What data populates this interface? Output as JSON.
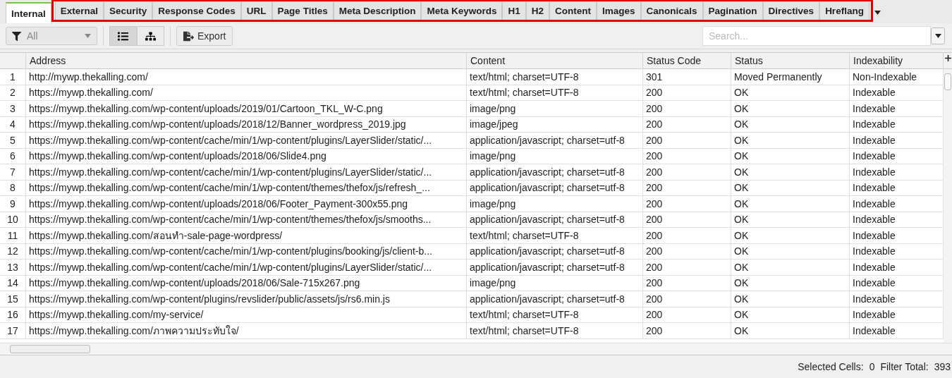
{
  "tabs": [
    {
      "label": "Internal",
      "selected": true,
      "highlighted": false
    },
    {
      "label": "External",
      "selected": false,
      "highlighted": true
    },
    {
      "label": "Security",
      "selected": false,
      "highlighted": true
    },
    {
      "label": "Response Codes",
      "selected": false,
      "highlighted": true
    },
    {
      "label": "URL",
      "selected": false,
      "highlighted": true
    },
    {
      "label": "Page Titles",
      "selected": false,
      "highlighted": true
    },
    {
      "label": "Meta Description",
      "selected": false,
      "highlighted": true
    },
    {
      "label": "Meta Keywords",
      "selected": false,
      "highlighted": true
    },
    {
      "label": "H1",
      "selected": false,
      "highlighted": true
    },
    {
      "label": "H2",
      "selected": false,
      "highlighted": true
    },
    {
      "label": "Content",
      "selected": false,
      "highlighted": true
    },
    {
      "label": "Images",
      "selected": false,
      "highlighted": true
    },
    {
      "label": "Canonicals",
      "selected": false,
      "highlighted": true
    },
    {
      "label": "Pagination",
      "selected": false,
      "highlighted": true
    },
    {
      "label": "Directives",
      "selected": false,
      "highlighted": true
    },
    {
      "label": "Hreflang",
      "selected": false,
      "highlighted": true
    }
  ],
  "toolbar": {
    "filter": "All",
    "view_modes": [
      {
        "kind": "list",
        "selected": true
      },
      {
        "kind": "tree",
        "selected": false
      }
    ],
    "export": "Export",
    "search_placeholder": "Search..."
  },
  "table": {
    "columns": [
      "",
      "Address",
      "Content",
      "Status Code",
      "Status",
      "Indexability"
    ],
    "rows": [
      [
        "1",
        "http://mywp.thekalling.com/",
        "text/html; charset=UTF-8",
        "301",
        "Moved Permanently",
        "Non-Indexable"
      ],
      [
        "2",
        "https://mywp.thekalling.com/",
        "text/html; charset=UTF-8",
        "200",
        "OK",
        "Indexable"
      ],
      [
        "3",
        "https://mywp.thekalling.com/wp-content/uploads/2019/01/Cartoon_TKL_W-C.png",
        "image/png",
        "200",
        "OK",
        "Indexable"
      ],
      [
        "4",
        "https://mywp.thekalling.com/wp-content/uploads/2018/12/Banner_wordpress_2019.jpg",
        "image/jpeg",
        "200",
        "OK",
        "Indexable"
      ],
      [
        "5",
        "https://mywp.thekalling.com/wp-content/cache/min/1/wp-content/plugins/LayerSlider/static/...",
        "application/javascript; charset=utf-8",
        "200",
        "OK",
        "Indexable"
      ],
      [
        "6",
        "https://mywp.thekalling.com/wp-content/uploads/2018/06/Slide4.png",
        "image/png",
        "200",
        "OK",
        "Indexable"
      ],
      [
        "7",
        "https://mywp.thekalling.com/wp-content/cache/min/1/wp-content/plugins/LayerSlider/static/...",
        "application/javascript; charset=utf-8",
        "200",
        "OK",
        "Indexable"
      ],
      [
        "8",
        "https://mywp.thekalling.com/wp-content/cache/min/1/wp-content/themes/thefox/js/refresh_...",
        "application/javascript; charset=utf-8",
        "200",
        "OK",
        "Indexable"
      ],
      [
        "9",
        "https://mywp.thekalling.com/wp-content/uploads/2018/06/Footer_Payment-300x55.png",
        "image/png",
        "200",
        "OK",
        "Indexable"
      ],
      [
        "10",
        "https://mywp.thekalling.com/wp-content/cache/min/1/wp-content/themes/thefox/js/smooths...",
        "application/javascript; charset=utf-8",
        "200",
        "OK",
        "Indexable"
      ],
      [
        "11",
        "https://mywp.thekalling.com/สอนทำ-sale-page-wordpress/",
        "text/html; charset=UTF-8",
        "200",
        "OK",
        "Indexable"
      ],
      [
        "12",
        "https://mywp.thekalling.com/wp-content/cache/min/1/wp-content/plugins/booking/js/client-b...",
        "application/javascript; charset=utf-8",
        "200",
        "OK",
        "Indexable"
      ],
      [
        "13",
        "https://mywp.thekalling.com/wp-content/cache/min/1/wp-content/plugins/LayerSlider/static/...",
        "application/javascript; charset=utf-8",
        "200",
        "OK",
        "Indexable"
      ],
      [
        "14",
        "https://mywp.thekalling.com/wp-content/uploads/2018/06/Sale-715x267.png",
        "image/png",
        "200",
        "OK",
        "Indexable"
      ],
      [
        "15",
        "https://mywp.thekalling.com/wp-content/plugins/revslider/public/assets/js/rs6.min.js",
        "application/javascript; charset=utf-8",
        "200",
        "OK",
        "Indexable"
      ],
      [
        "16",
        "https://mywp.thekalling.com/my-service/",
        "text/html; charset=UTF-8",
        "200",
        "OK",
        "Indexable"
      ],
      [
        "17",
        "https://mywp.thekalling.com/ภาพความประทับใจ/",
        "text/html; charset=UTF-8",
        "200",
        "OK",
        "Indexable"
      ]
    ]
  },
  "status_bar": [
    {
      "label": "Selected Cells:",
      "value": "0"
    },
    {
      "label": "Filter Total:",
      "value": "393"
    }
  ]
}
